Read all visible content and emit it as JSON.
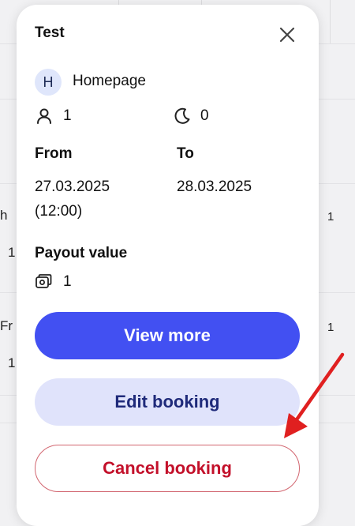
{
  "background": {
    "fragments": [
      "h",
      "1",
      "Fr",
      "1",
      "1",
      "1"
    ]
  },
  "popup": {
    "title": "Test",
    "property": {
      "initial": "H",
      "name": "Homepage"
    },
    "guests": "1",
    "nights": "0",
    "from_label": "From",
    "to_label": "To",
    "from_date": "27.03.2025",
    "from_time": "(12:00)",
    "to_date": "28.03.2025",
    "payout_label": "Payout value",
    "payout_value": "1",
    "buttons": {
      "view_more": "View more",
      "edit_booking": "Edit booking",
      "cancel_booking": "Cancel booking"
    }
  },
  "colors": {
    "primary": "#4250f2",
    "secondary_bg": "#e0e3fb",
    "danger": "#c3102a",
    "annotation_arrow": "#e02020"
  },
  "icons": [
    "close-icon",
    "user-icon",
    "moon-icon",
    "cash-icon",
    "annotation-arrow"
  ]
}
